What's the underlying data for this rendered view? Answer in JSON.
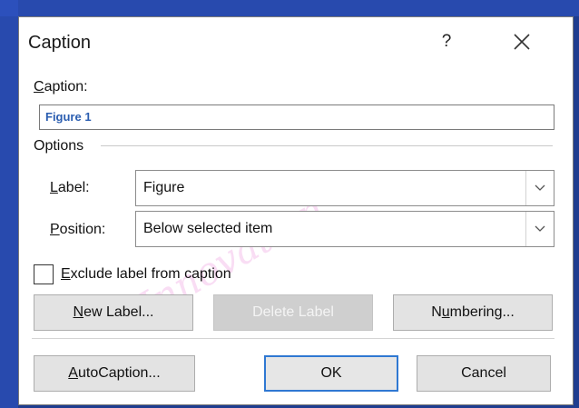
{
  "dialog": {
    "title": "Caption",
    "help_label": "?",
    "close_icon": "close-icon"
  },
  "caption": {
    "label_prefix": "",
    "label_mnemonic": "C",
    "label_rest": "aption:",
    "value": "Figure 1"
  },
  "options": {
    "heading": "Options",
    "label_field": {
      "label_mnemonic": "L",
      "label_rest": "abel:",
      "value": "Figure"
    },
    "position_field": {
      "label_mnemonic": "P",
      "label_rest": "osition:",
      "value": "Below selected item"
    },
    "exclude": {
      "mnemonic": "E",
      "rest": "xclude label from caption",
      "checked": false
    }
  },
  "buttons": {
    "new_label": {
      "mnemonic": "N",
      "rest": "ew Label..."
    },
    "delete_label": {
      "text": "Delete Label"
    },
    "numbering": {
      "pre": "N",
      "mnemonic": "u",
      "rest": "mbering..."
    },
    "autocaption": {
      "mnemonic": "A",
      "rest": "utoCaption..."
    },
    "ok": {
      "text": "OK"
    },
    "cancel": {
      "text": "Cancel"
    }
  },
  "colors": {
    "accent": "#2f78d2",
    "background": "#1f3d8f"
  }
}
